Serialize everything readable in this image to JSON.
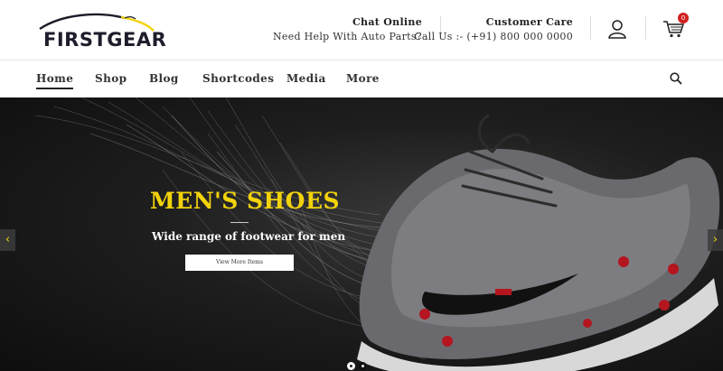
{
  "header": {
    "logo_text": "FIRSTGEAR",
    "chat": {
      "title": "Chat Online",
      "subtitle": "Need Help With Auto Parts?"
    },
    "care": {
      "title": "Customer Care",
      "subtitle": "Call Us :- (+91) 800 000 0000"
    },
    "cart_count": "0"
  },
  "nav": {
    "items": [
      {
        "label": "Home",
        "active": true
      },
      {
        "label": "Shop"
      },
      {
        "label": "Blog"
      },
      {
        "label": "Shortcodes"
      },
      {
        "label": "Media"
      },
      {
        "label": "More"
      }
    ]
  },
  "hero": {
    "title": "MEN'S SHOES",
    "subtitle": "Wide range of footwear for men",
    "button_label": "View More Items",
    "prev_icon": "chevron-left-icon",
    "next_icon": "chevron-right-icon",
    "slide_count": 2,
    "active_slide": 1
  },
  "colors": {
    "accent_yellow": "#f2d30b",
    "badge_red": "#d32020",
    "hero_dark": "#1e1e1e"
  }
}
